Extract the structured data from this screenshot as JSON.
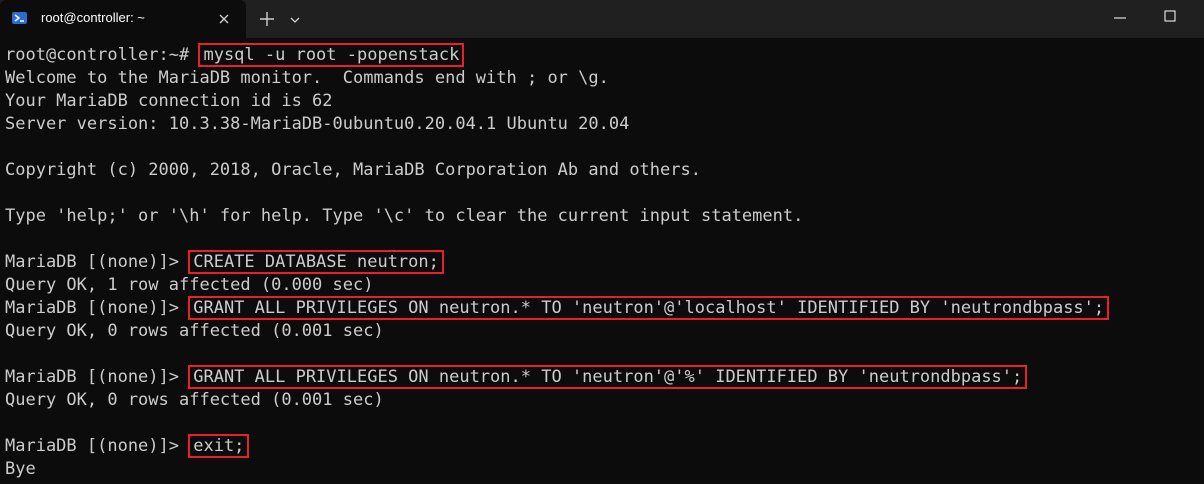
{
  "window": {
    "tab_title": "root@controller: ~"
  },
  "terminal": {
    "lines": [
      {
        "prompt": "root@controller:~# ",
        "command": "mysql -u root -popenstack"
      },
      {
        "text": "Welcome to the MariaDB monitor.  Commands end with ; or \\g."
      },
      {
        "text": "Your MariaDB connection id is 62"
      },
      {
        "text": "Server version: 10.3.38-MariaDB-0ubuntu0.20.04.1 Ubuntu 20.04"
      },
      {
        "text": ""
      },
      {
        "text": "Copyright (c) 2000, 2018, Oracle, MariaDB Corporation Ab and others."
      },
      {
        "text": ""
      },
      {
        "text": "Type 'help;' or '\\h' for help. Type '\\c' to clear the current input statement."
      },
      {
        "text": ""
      },
      {
        "prompt": "MariaDB [(none)]> ",
        "command": "CREATE DATABASE neutron;"
      },
      {
        "text": "Query OK, 1 row affected (0.000 sec)"
      },
      {
        "prompt": "MariaDB [(none)]> ",
        "command": "GRANT ALL PRIVILEGES ON neutron.* TO 'neutron'@'localhost' IDENTIFIED BY 'neutrondbpass';"
      },
      {
        "text": "Query OK, 0 rows affected (0.001 sec)"
      },
      {
        "text": ""
      },
      {
        "prompt": "MariaDB [(none)]> ",
        "command": "GRANT ALL PRIVILEGES ON neutron.* TO 'neutron'@'%' IDENTIFIED BY 'neutrondbpass';"
      },
      {
        "text": "Query OK, 0 rows affected (0.001 sec)"
      },
      {
        "text": ""
      },
      {
        "prompt": "MariaDB [(none)]> ",
        "command": "exit;"
      },
      {
        "text": "Bye"
      }
    ]
  },
  "icons": {
    "tab_icon": "powershell-icon",
    "close": "close-icon",
    "new_tab": "plus-icon",
    "dropdown": "chevron-down-icon",
    "minimize": "minimize-icon",
    "maximize": "maximize-icon"
  },
  "colors": {
    "background": "#0c0c0c",
    "titlebar": "#202020",
    "text": "#cccccc",
    "highlight_border": "#e8202a",
    "tab_icon": "#2a6ccf"
  }
}
